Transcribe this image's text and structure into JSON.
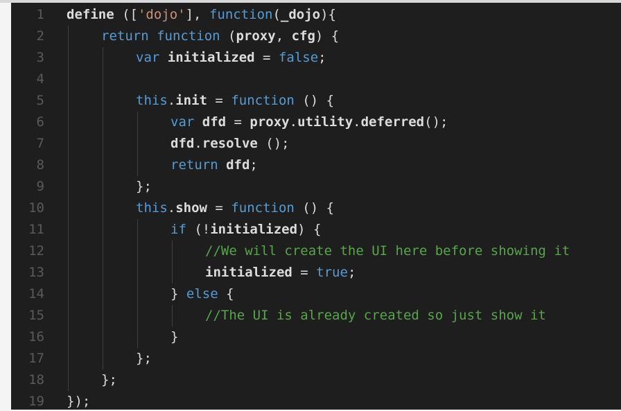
{
  "editor": {
    "lines": [
      {
        "n": "1",
        "indent": 0,
        "tokens": [
          [
            "t-fn",
            "define "
          ],
          [
            "t-pun",
            "(["
          ],
          [
            "t-str",
            "'dojo'"
          ],
          [
            "t-pun",
            "], "
          ],
          [
            "t-kw",
            "function"
          ],
          [
            "t-pun",
            "("
          ],
          [
            "t-var",
            "_dojo"
          ],
          [
            "t-pun",
            "){"
          ]
        ]
      },
      {
        "n": "2",
        "indent": 1,
        "tokens": [
          [
            "t-kw",
            "return "
          ],
          [
            "t-kw",
            "function "
          ],
          [
            "t-pun",
            "("
          ],
          [
            "t-var",
            "proxy"
          ],
          [
            "t-pun",
            ", "
          ],
          [
            "t-var",
            "cfg"
          ],
          [
            "t-pun",
            ") {"
          ]
        ]
      },
      {
        "n": "3",
        "indent": 2,
        "tokens": [
          [
            "t-kw",
            "var "
          ],
          [
            "t-var",
            "initialized"
          ],
          [
            "t-pun",
            " = "
          ],
          [
            "t-bool",
            "false"
          ],
          [
            "t-pun",
            ";"
          ]
        ]
      },
      {
        "n": "4",
        "indent": 2,
        "tokens": []
      },
      {
        "n": "5",
        "indent": 2,
        "tokens": [
          [
            "t-kw",
            "this"
          ],
          [
            "t-pun",
            "."
          ],
          [
            "t-var",
            "init"
          ],
          [
            "t-pun",
            " = "
          ],
          [
            "t-kw",
            "function "
          ],
          [
            "t-pun",
            "() {"
          ]
        ]
      },
      {
        "n": "6",
        "indent": 3,
        "tokens": [
          [
            "t-kw",
            "var "
          ],
          [
            "t-var",
            "dfd"
          ],
          [
            "t-pun",
            " = "
          ],
          [
            "t-var",
            "proxy"
          ],
          [
            "t-pun",
            "."
          ],
          [
            "t-var",
            "utility"
          ],
          [
            "t-pun",
            "."
          ],
          [
            "t-var",
            "deferred"
          ],
          [
            "t-pun",
            "();"
          ]
        ]
      },
      {
        "n": "7",
        "indent": 3,
        "tokens": [
          [
            "t-var",
            "dfd"
          ],
          [
            "t-pun",
            "."
          ],
          [
            "t-var",
            "resolve"
          ],
          [
            "t-pun",
            " ();"
          ]
        ]
      },
      {
        "n": "8",
        "indent": 3,
        "tokens": [
          [
            "t-kw",
            "return "
          ],
          [
            "t-var",
            "dfd"
          ],
          [
            "t-pun",
            ";"
          ]
        ]
      },
      {
        "n": "9",
        "indent": 2,
        "tokens": [
          [
            "t-pun",
            "};"
          ]
        ]
      },
      {
        "n": "10",
        "indent": 2,
        "tokens": [
          [
            "t-kw",
            "this"
          ],
          [
            "t-pun",
            "."
          ],
          [
            "t-var",
            "show"
          ],
          [
            "t-pun",
            " = "
          ],
          [
            "t-kw",
            "function "
          ],
          [
            "t-pun",
            "() {"
          ]
        ]
      },
      {
        "n": "11",
        "indent": 3,
        "tokens": [
          [
            "t-kw",
            "if "
          ],
          [
            "t-pun",
            "(!"
          ],
          [
            "t-var",
            "initialized"
          ],
          [
            "t-pun",
            ") {"
          ]
        ]
      },
      {
        "n": "12",
        "indent": 4,
        "tokens": [
          [
            "t-com",
            "//We will create the UI here before showing it"
          ]
        ]
      },
      {
        "n": "13",
        "indent": 4,
        "tokens": [
          [
            "t-var",
            "initialized"
          ],
          [
            "t-pun",
            " = "
          ],
          [
            "t-bool",
            "true"
          ],
          [
            "t-pun",
            ";"
          ]
        ]
      },
      {
        "n": "14",
        "indent": 3,
        "tokens": [
          [
            "t-pun",
            "} "
          ],
          [
            "t-kw",
            "else "
          ],
          [
            "t-pun",
            "{"
          ]
        ]
      },
      {
        "n": "15",
        "indent": 4,
        "tokens": [
          [
            "t-com",
            "//The UI is already created so just show it"
          ]
        ]
      },
      {
        "n": "16",
        "indent": 3,
        "tokens": [
          [
            "t-pun",
            "}"
          ]
        ]
      },
      {
        "n": "17",
        "indent": 2,
        "tokens": [
          [
            "t-pun",
            "};"
          ]
        ]
      },
      {
        "n": "18",
        "indent": 1,
        "tokens": [
          [
            "t-pun",
            "};"
          ]
        ]
      },
      {
        "n": "19",
        "indent": 0,
        "tokens": [
          [
            "t-pun",
            "});"
          ]
        ]
      }
    ]
  }
}
